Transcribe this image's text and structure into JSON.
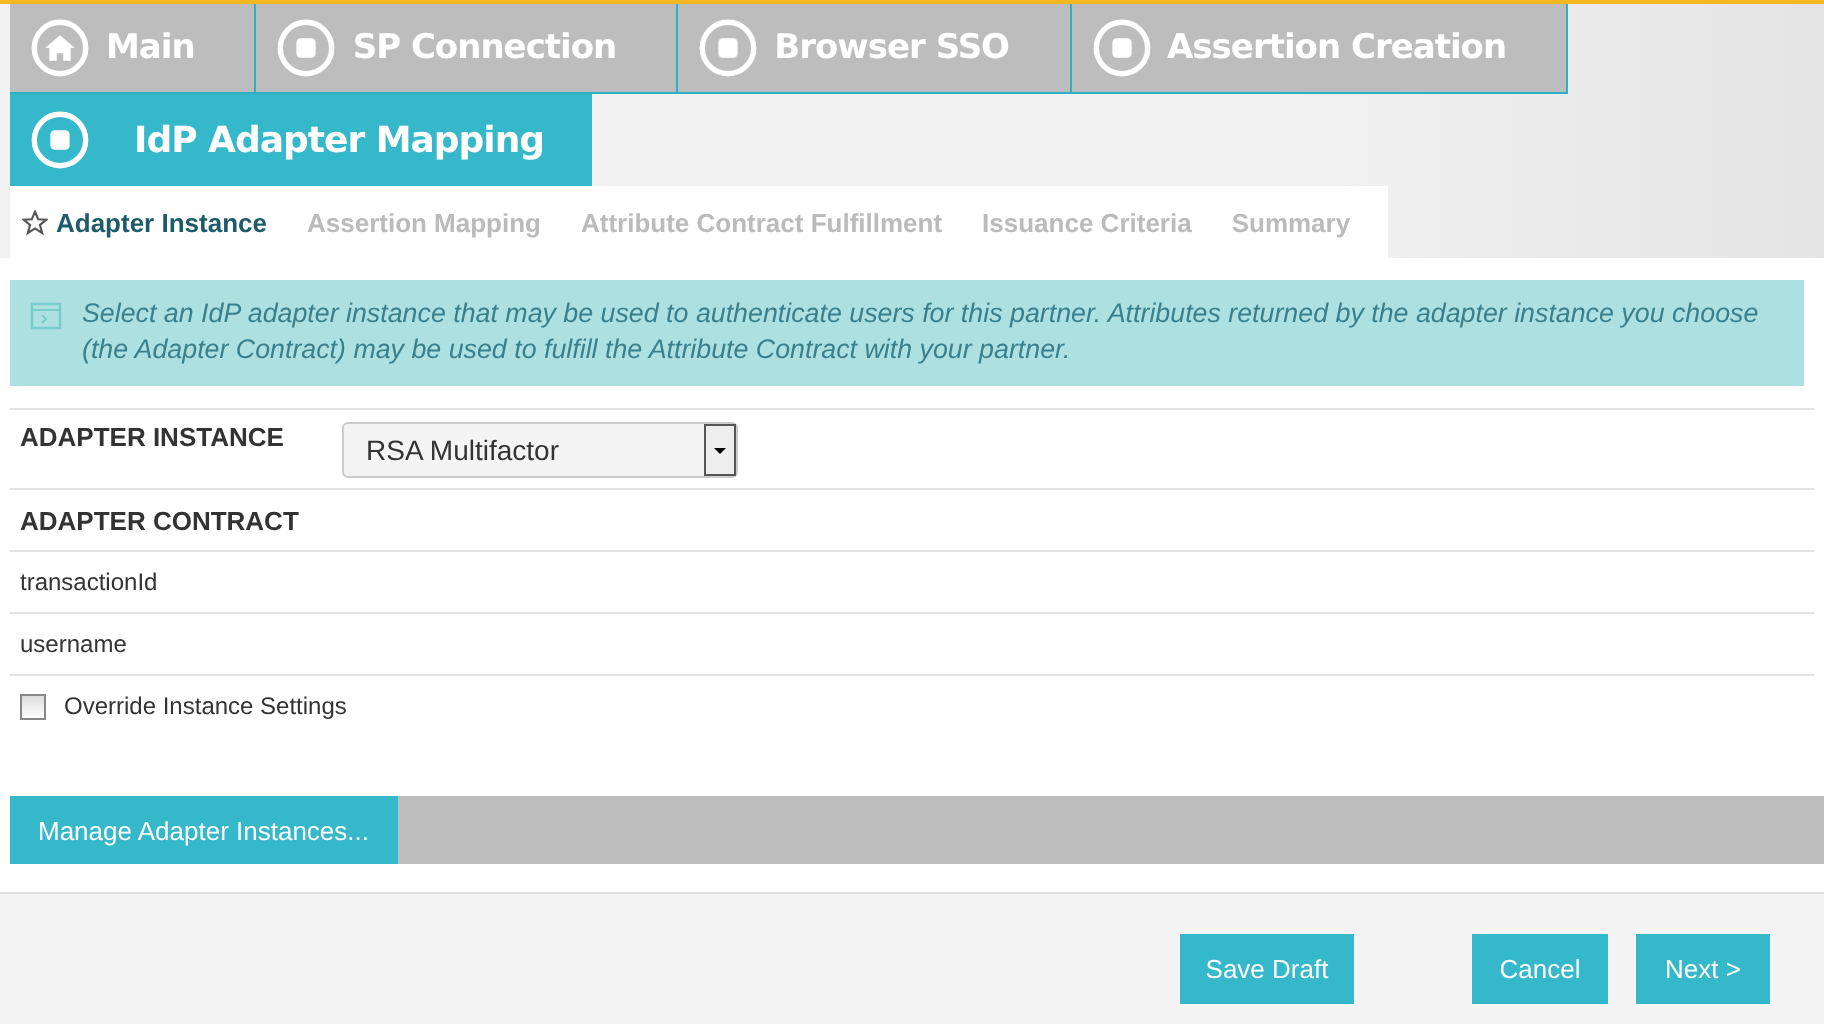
{
  "breadcrumbs": [
    {
      "label": "Main",
      "kind": "home",
      "selected": false
    },
    {
      "label": "SP Connection",
      "kind": "step",
      "selected": false
    },
    {
      "label": "Browser SSO",
      "kind": "step",
      "selected": false
    },
    {
      "label": "Assertion Creation",
      "kind": "step",
      "selected": false
    },
    {
      "label": "IdP Adapter Mapping",
      "kind": "step",
      "selected": true
    }
  ],
  "tabs": [
    {
      "label": "Adapter Instance",
      "selected": true
    },
    {
      "label": "Assertion Mapping",
      "selected": false
    },
    {
      "label": "Attribute Contract Fulfillment",
      "selected": false
    },
    {
      "label": "Issuance Criteria",
      "selected": false
    },
    {
      "label": "Summary",
      "selected": false
    }
  ],
  "info": "Select an IdP adapter instance that may be used to authenticate users for this partner. Attributes returned by the adapter instance you choose (the Adapter Contract) may be used to fulfill the Attribute Contract with your partner.",
  "adapter_instance": {
    "label": "ADAPTER INSTANCE",
    "value": "RSA Multifactor"
  },
  "adapter_contract": {
    "label": "ADAPTER CONTRACT",
    "attributes": [
      "transactionId",
      "username"
    ]
  },
  "override": {
    "label": "Override Instance Settings",
    "checked": false
  },
  "manage_button": "Manage Adapter Instances...",
  "footer_buttons": [
    "Save Draft",
    "Cancel",
    "Next >"
  ]
}
